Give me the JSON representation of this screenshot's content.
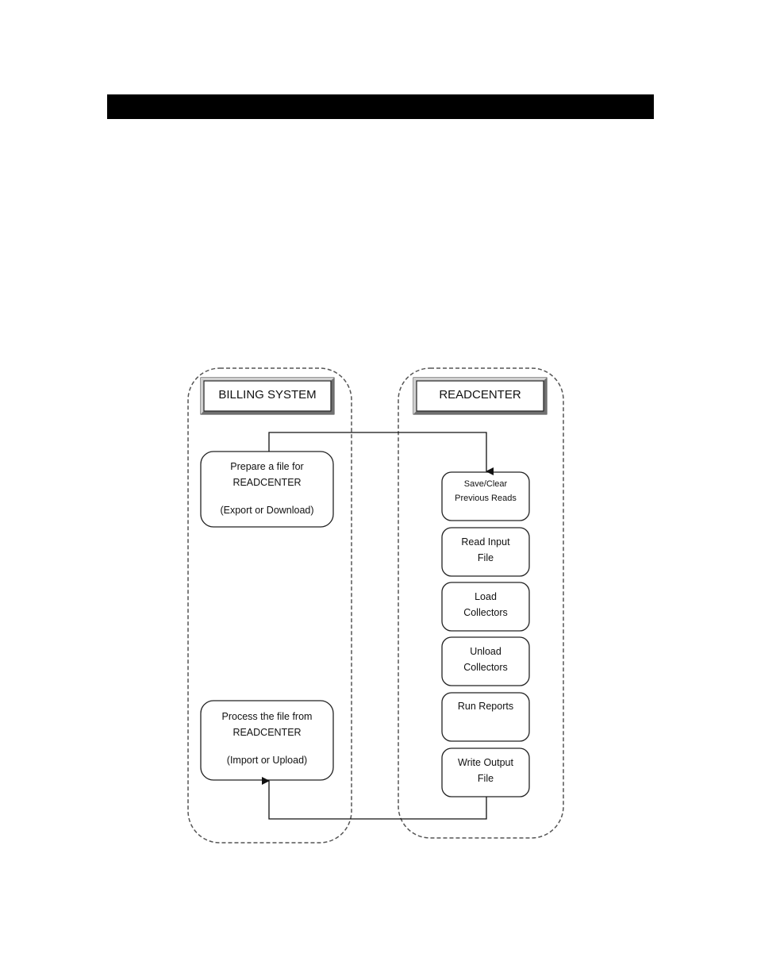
{
  "page": {
    "title_bar_text": ""
  },
  "diagram": {
    "lanes": [
      {
        "id": "billing",
        "title": "BILLING SYSTEM"
      },
      {
        "id": "readcenter",
        "title": "READCENTER"
      }
    ],
    "billing_steps": [
      {
        "lines": [
          "Prepare a file for",
          "READCENTER",
          "",
          "(Export or Download)"
        ]
      },
      {
        "lines": [
          "Process the file from",
          "READCENTER",
          "",
          "(Import or Upload)"
        ]
      }
    ],
    "readcenter_steps": [
      {
        "lines": [
          "Save/Clear",
          "Previous Reads"
        ]
      },
      {
        "lines": [
          "Read Input",
          "File"
        ]
      },
      {
        "lines": [
          "Load",
          "Collectors"
        ]
      },
      {
        "lines": [
          "Unload",
          "Collectors"
        ]
      },
      {
        "lines": [
          "Run Reports"
        ]
      },
      {
        "lines": [
          "Write Output",
          "File"
        ]
      }
    ],
    "connectors": [
      {
        "from": "Prepare a file for READCENTER",
        "to": "Save/Clear Previous Reads"
      },
      {
        "from": "Write Output File",
        "to": "Process the file from READCENTER"
      }
    ]
  }
}
